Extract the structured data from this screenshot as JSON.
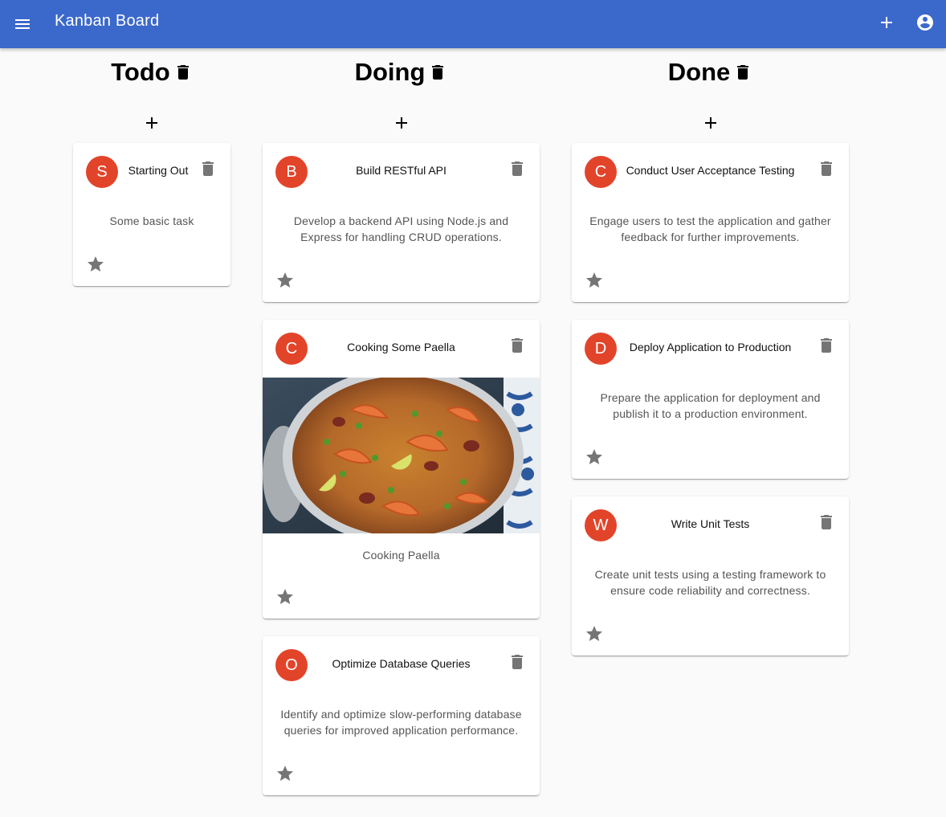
{
  "appbar": {
    "title": "Kanban Board",
    "menu_icon": "menu-icon",
    "add_icon": "add-icon",
    "account_icon": "account-circle-icon",
    "background": "#3b68cb"
  },
  "columns": [
    {
      "title": "Todo",
      "cards": [
        {
          "avatar": "S",
          "title": "Starting Out",
          "description": "Some basic task"
        }
      ]
    },
    {
      "title": "Doing",
      "cards": [
        {
          "avatar": "B",
          "title": "Build RESTful API",
          "description": "Develop a backend API using Node.js and Express for handling CRUD operations."
        },
        {
          "avatar": "C",
          "title": "Cooking Some Paella",
          "description": "Cooking Paella",
          "image": "paella-photo"
        },
        {
          "avatar": "O",
          "title": "Optimize Database Queries",
          "description": "Identify and optimize slow-performing database queries for improved application performance."
        }
      ]
    },
    {
      "title": "Done",
      "cards": [
        {
          "avatar": "C",
          "title": "Conduct User Acceptance Testing",
          "description": "Engage users to test the application and gather feedback for further improvements."
        },
        {
          "avatar": "D",
          "title": "Deploy Application to Production",
          "description": "Prepare the application for deployment and publish it to a production environment."
        },
        {
          "avatar": "W",
          "title": "Write Unit Tests",
          "description": "Create unit tests using a testing framework to ensure code reliability and correctness."
        }
      ]
    }
  ],
  "colors": {
    "avatar": "#e2442a",
    "icon_grey": "#757575"
  }
}
